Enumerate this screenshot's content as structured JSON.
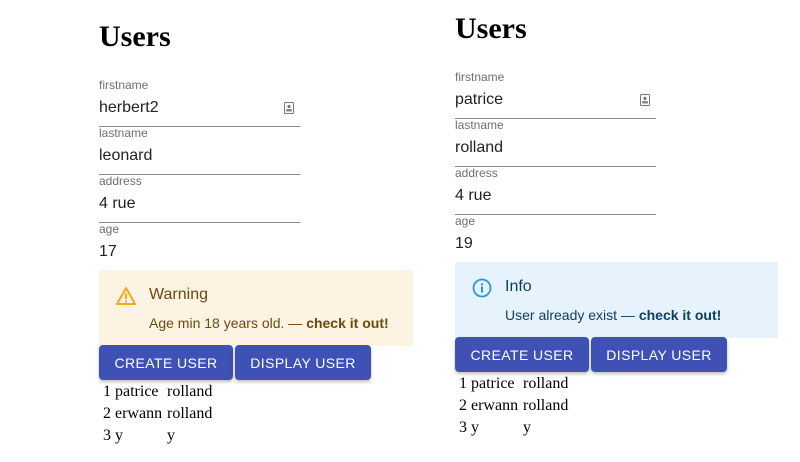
{
  "left": {
    "title": "Users",
    "fields": [
      {
        "label": "firstname",
        "value": "herbert2"
      },
      {
        "label": "lastname",
        "value": "leonard"
      },
      {
        "label": "address",
        "value": "4 rue"
      },
      {
        "label": "age",
        "value": "17"
      }
    ],
    "alert": {
      "severity": "warning",
      "icon": "warning-triangle-icon",
      "title": "Warning",
      "message": "Age min 18 years old. — ",
      "link": "check it out!"
    },
    "buttons": {
      "create": "Create User",
      "display": "Display User"
    },
    "users": [
      {
        "first": "1 patrice",
        "last": "rolland"
      },
      {
        "first": "2 erwann",
        "last": "rolland"
      },
      {
        "first": "3 y",
        "last": "y"
      }
    ]
  },
  "right": {
    "title": "Users",
    "fields": [
      {
        "label": "firstname",
        "value": "patrice"
      },
      {
        "label": "lastname",
        "value": "rolland"
      },
      {
        "label": "address",
        "value": "4 rue"
      },
      {
        "label": "age",
        "value": "19"
      }
    ],
    "alert": {
      "severity": "info",
      "icon": "info-circle-icon",
      "title": "Info",
      "message": "User already exist — ",
      "link": "check it out!"
    },
    "buttons": {
      "create": "Create User",
      "display": "Display User"
    },
    "users": [
      {
        "first": "1 patrice",
        "last": "rolland"
      },
      {
        "first": "2 erwann",
        "last": "rolland"
      },
      {
        "first": "3 y",
        "last": "y"
      }
    ]
  },
  "colors": {
    "primary_button": "#3f51b5",
    "warning_bg": "#fdf3e3",
    "warning_icon": "#f5a623",
    "info_bg": "#e6f3fd",
    "info_icon": "#2196f3"
  }
}
